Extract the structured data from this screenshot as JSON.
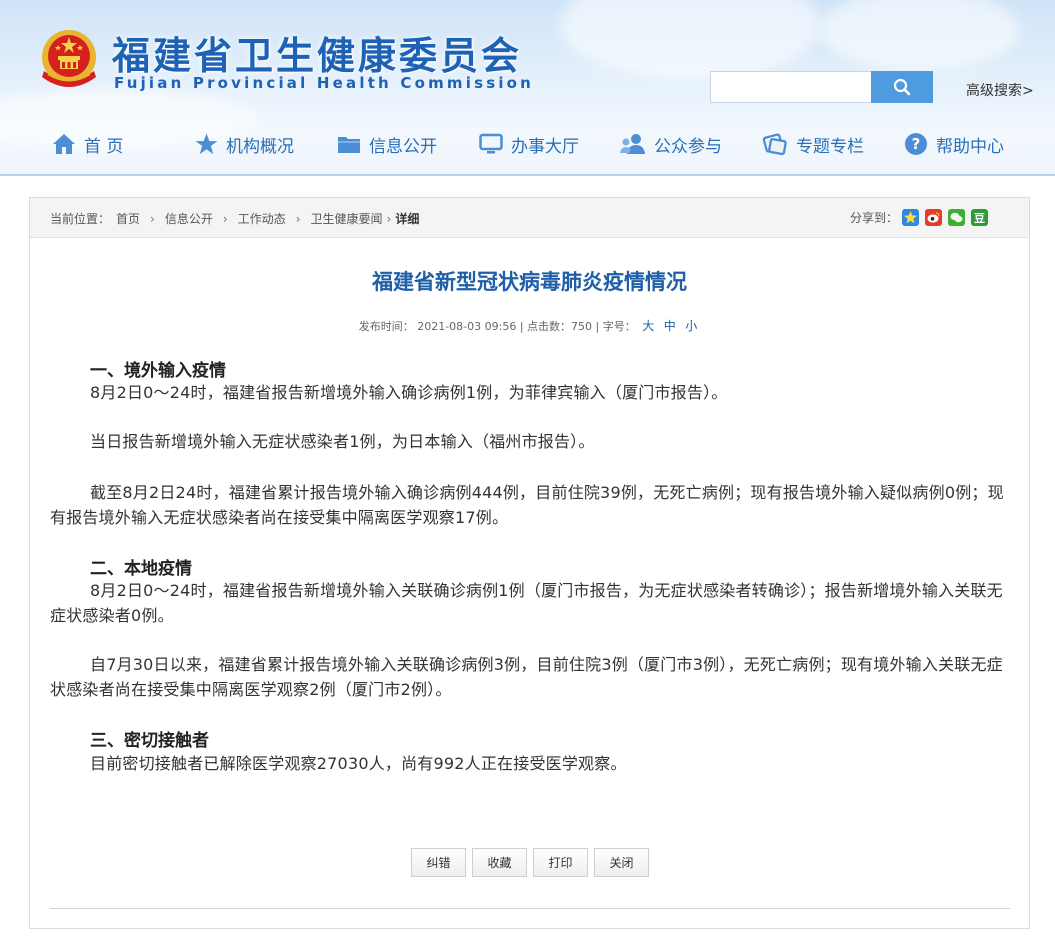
{
  "header": {
    "title_cn": "福建省卫生健康委员会",
    "title_en": "Fujian Provincial Health Commission",
    "search_placeholder": "",
    "advanced_search": "高级搜索>"
  },
  "nav": {
    "items": [
      {
        "label": "首 页",
        "icon": "home-icon"
      },
      {
        "label": "机构概况",
        "icon": "star-icon"
      },
      {
        "label": "信息公开",
        "icon": "folder-icon"
      },
      {
        "label": "办事大厅",
        "icon": "monitor-icon"
      },
      {
        "label": "公众参与",
        "icon": "people-icon"
      },
      {
        "label": "专题专栏",
        "icon": "tag-icon"
      },
      {
        "label": "帮助中心",
        "icon": "help-icon"
      }
    ]
  },
  "breadcrumb": {
    "prefix": "当前位置：",
    "items": [
      "首页",
      "信息公开",
      "工作动态",
      "卫生健康要闻"
    ],
    "current": "详细",
    "share_label": "分享到："
  },
  "article": {
    "title": "福建省新型冠状病毒肺炎疫情情况",
    "meta_prefix": "发布时间： 2021-08-03 09:56 | 点击数：750 | 字号：",
    "size_large": "大",
    "size_medium": "中",
    "size_small": "小",
    "sections": [
      {
        "heading": "一、境外输入疫情",
        "paragraphs": [
          "8月2日0～24时，福建省报告新增境外输入确诊病例1例，为菲律宾输入（厦门市报告）。",
          "当日报告新增境外输入无症状感染者1例，为日本输入（福州市报告）。",
          "截至8月2日24时，福建省累计报告境外输入确诊病例444例，目前住院39例，无死亡病例；现有报告境外输入疑似病例0例；现有报告境外输入无症状感染者尚在接受集中隔离医学观察17例。"
        ]
      },
      {
        "heading": "二、本地疫情",
        "paragraphs": [
          "8月2日0～24时，福建省报告新增境外输入关联确诊病例1例（厦门市报告，为无症状感染者转确诊）；报告新增境外输入关联无症状感染者0例。",
          "自7月30日以来，福建省累计报告境外输入关联确诊病例3例，目前住院3例（厦门市3例），无死亡病例；现有境外输入关联无症状感染者尚在接受集中隔离医学观察2例（厦门市2例）。"
        ]
      },
      {
        "heading": "三、密切接触者",
        "paragraphs": [
          "目前密切接触者已解除医学观察27030人，尚有992人正在接受医学观察。"
        ]
      }
    ]
  },
  "buttons": {
    "correct": "纠错",
    "favorite": "收藏",
    "print": "打印",
    "close": "关闭"
  },
  "colors": {
    "brand_blue": "#1d62b5",
    "title_blue": "#1f5fa8",
    "search_btn": "#4f9be0"
  }
}
